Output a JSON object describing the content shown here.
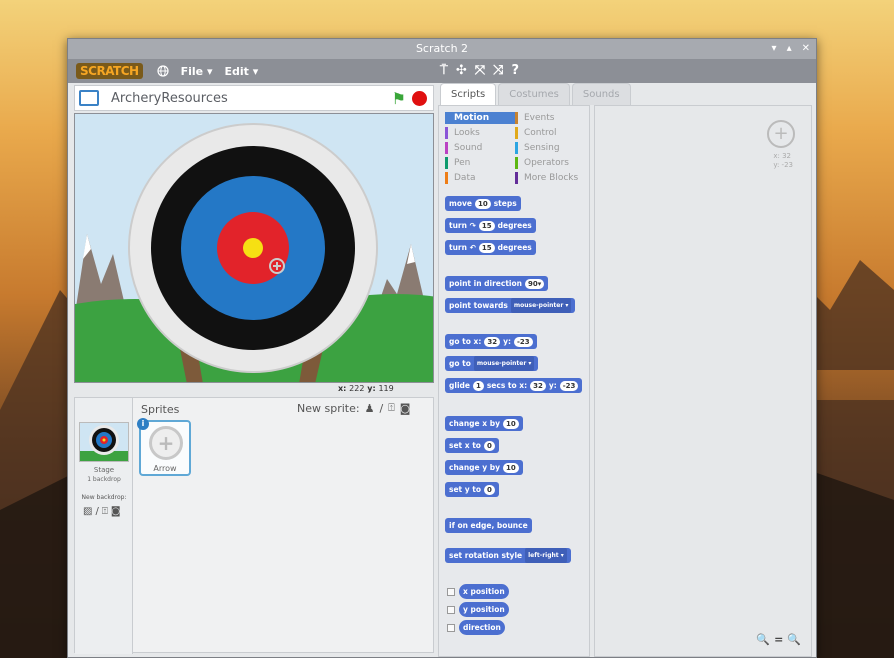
{
  "window": {
    "title": "Scratch 2",
    "controls": [
      "▾",
      "▴",
      "✕"
    ]
  },
  "menubar": {
    "logo": "SCRATCH",
    "items": [
      {
        "label": "File ▾"
      },
      {
        "label": "Edit ▾"
      }
    ]
  },
  "stage": {
    "project_title": "ArcheryResources",
    "mouse_x_label": "x:",
    "mouse_x_value": "222",
    "mouse_y_label": "y:",
    "mouse_y_value": "119"
  },
  "sprites_pane": {
    "heading": "Sprites",
    "new_sprite_label": "New sprite:",
    "stage_label": "Stage",
    "backdrops_count": "1 backdrop",
    "new_backdrop_label": "New backdrop:",
    "sprite_name": "Arrow"
  },
  "tabs": [
    {
      "label": "Scripts",
      "active": true
    },
    {
      "label": "Costumes",
      "active": false
    },
    {
      "label": "Sounds",
      "active": false
    }
  ],
  "categories": [
    {
      "label": "Motion",
      "color": "#4c81d1",
      "active": true
    },
    {
      "label": "Events",
      "color": "#c88330"
    },
    {
      "label": "Looks",
      "color": "#8a55d7"
    },
    {
      "label": "Control",
      "color": "#e1a91a"
    },
    {
      "label": "Sound",
      "color": "#bb42c3"
    },
    {
      "label": "Sensing",
      "color": "#2ca5e2"
    },
    {
      "label": "Pen",
      "color": "#0e9a6c"
    },
    {
      "label": "Operators",
      "color": "#5cb712"
    },
    {
      "label": "Data",
      "color": "#ee7d16"
    },
    {
      "label": "More Blocks",
      "color": "#632d99"
    }
  ],
  "blocks": {
    "move": {
      "pre": "move",
      "val": "10",
      "post": "steps"
    },
    "turn_right": {
      "pre": "turn ↷",
      "val": "15",
      "post": "degrees"
    },
    "turn_left": {
      "pre": "turn ↶",
      "val": "15",
      "post": "degrees"
    },
    "point_direction": {
      "pre": "point in direction",
      "val": "90▾"
    },
    "point_towards": {
      "pre": "point towards",
      "drop": "mouse-pointer ▾"
    },
    "go_to_xy": {
      "pre": "go to x:",
      "x": "32",
      "mid": "y:",
      "y": "-23"
    },
    "go_to": {
      "pre": "go to",
      "drop": "mouse-pointer ▾"
    },
    "glide": {
      "pre": "glide",
      "secs": "1",
      "mid1": "secs to x:",
      "x": "32",
      "mid2": "y:",
      "y": "-23"
    },
    "change_x": {
      "pre": "change x by",
      "val": "10"
    },
    "set_x": {
      "pre": "set x to",
      "val": "0"
    },
    "change_y": {
      "pre": "change y by",
      "val": "10"
    },
    "set_y": {
      "pre": "set y to",
      "val": "0"
    },
    "bounce": {
      "pre": "if on edge, bounce"
    },
    "rotation_style": {
      "pre": "set rotation style",
      "drop": "left-right ▾"
    },
    "x_position": {
      "pre": "x position"
    },
    "y_position": {
      "pre": "y position"
    },
    "direction": {
      "pre": "direction"
    }
  },
  "script_area": {
    "sprite_x_label": "x: 32",
    "sprite_y_label": "y: -23",
    "zoom_out": "🔍",
    "zoom_reset": "=",
    "zoom_in": "🔍"
  }
}
